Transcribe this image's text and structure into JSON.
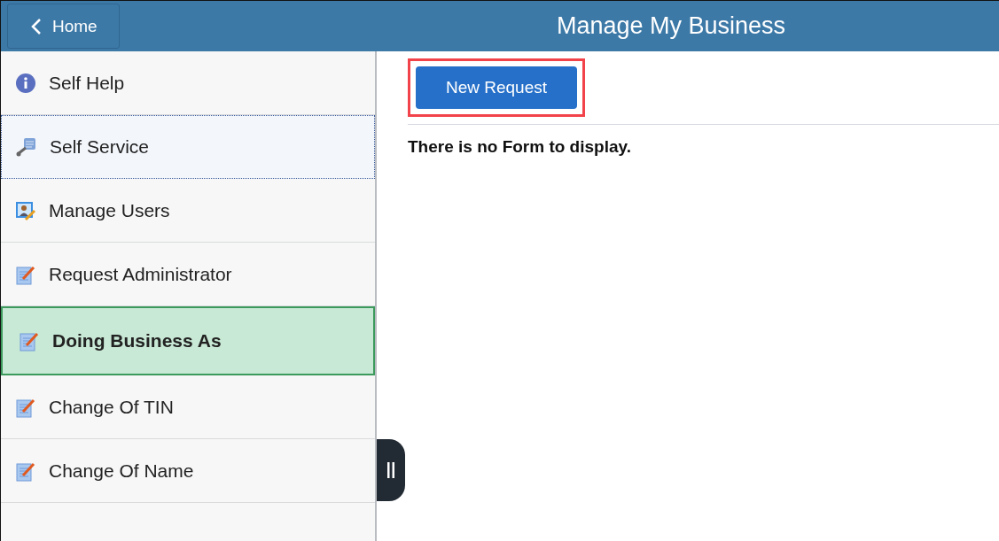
{
  "header": {
    "back_button": {
      "label": "Home"
    },
    "title": "Manage My Business"
  },
  "sidebar": {
    "items": [
      {
        "label": "Self Help",
        "kind": "help",
        "selected": false,
        "focused": false
      },
      {
        "label": "Self Service",
        "kind": "service",
        "selected": false,
        "focused": true
      },
      {
        "label": "Manage Users",
        "kind": "users",
        "selected": false,
        "focused": false
      },
      {
        "label": "Request Administrator",
        "kind": "form",
        "selected": false,
        "focused": false
      },
      {
        "label": "Doing Business As",
        "kind": "form",
        "selected": true,
        "focused": false
      },
      {
        "label": "Change Of TIN",
        "kind": "form",
        "selected": false,
        "focused": false
      },
      {
        "label": "Change Of Name",
        "kind": "form",
        "selected": false,
        "focused": false
      }
    ]
  },
  "content": {
    "new_request_button": {
      "label": "New Request",
      "highlighted": true
    },
    "message": "There is no Form to display."
  }
}
